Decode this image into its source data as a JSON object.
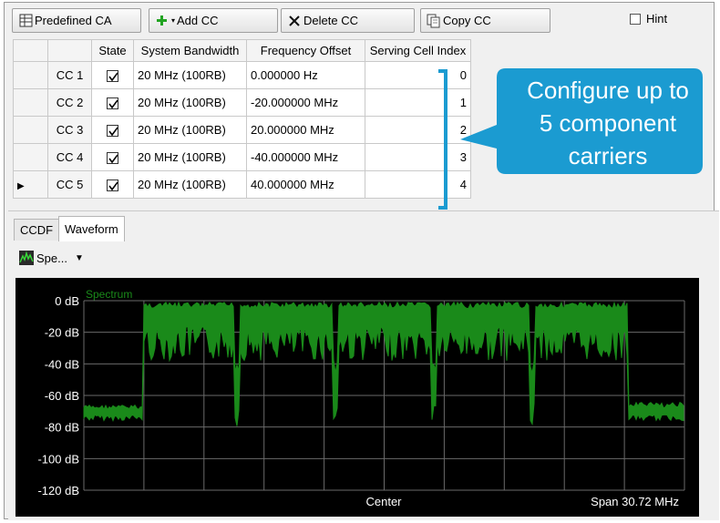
{
  "toolbar": {
    "predefined_label": "Predefined CA",
    "add_label": "Add CC",
    "delete_label": "Delete CC",
    "copy_label": "Copy CC",
    "hint_label": "Hint"
  },
  "table": {
    "headers": [
      "State",
      "System Bandwidth",
      "Frequency Offset",
      "Serving Cell Index"
    ],
    "rows": [
      {
        "name": "CC 1",
        "state": true,
        "bandwidth": "20 MHz (100RB)",
        "offset": "0.000000 Hz",
        "index": "0"
      },
      {
        "name": "CC 2",
        "state": true,
        "bandwidth": "20 MHz (100RB)",
        "offset": "-20.000000 MHz",
        "index": "1"
      },
      {
        "name": "CC 3",
        "state": true,
        "bandwidth": "20 MHz (100RB)",
        "offset": "20.000000 MHz",
        "index": "2"
      },
      {
        "name": "CC 4",
        "state": true,
        "bandwidth": "20 MHz (100RB)",
        "offset": "-40.000000 MHz",
        "index": "3"
      },
      {
        "name": "CC 5",
        "state": true,
        "bandwidth": "20 MHz (100RB)",
        "offset": "40.000000 MHz",
        "index": "4"
      }
    ]
  },
  "callout": {
    "line1": "Configure up to",
    "line2": "5 component",
    "line3": "carriers",
    "color": "#1b9bd1"
  },
  "tabs": [
    "CCDF",
    "Waveform"
  ],
  "view_select": {
    "label": "Spe..."
  },
  "plot": {
    "title": "Spectrum",
    "y_ticks": [
      "0 dB",
      "-20 dB",
      "-40 dB",
      "-60 dB",
      "-80 dB",
      "-100 dB",
      "-120 dB"
    ],
    "center_label": "Center",
    "span_label": "Span 30.72 MHz",
    "trace_color": "#1a8a1a",
    "grid_color": "#6a6a6a"
  }
}
